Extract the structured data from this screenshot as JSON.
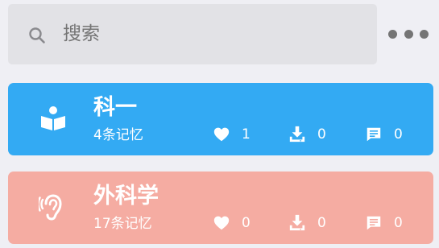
{
  "search": {
    "placeholder": "搜索"
  },
  "header": {
    "more_icon": "more-horizontal-icon"
  },
  "cards": [
    {
      "title": "科一",
      "subtitle": "4条记忆",
      "icon": "book-reader-icon",
      "color": "#33aaf3",
      "likes": "1",
      "downloads": "0",
      "comments": "0"
    },
    {
      "title": "外科学",
      "subtitle": "17条记忆",
      "icon": "ear-icon",
      "color": "#f5aca2",
      "likes": "0",
      "downloads": "0",
      "comments": "0"
    }
  ],
  "icons": {
    "like": "heart-icon",
    "download": "download-icon",
    "comment": "comment-icon"
  },
  "colors": {
    "background": "#efeff4",
    "search_background": "#e2e2e6",
    "text_on_card": "#ffffff",
    "muted": "#8e8e93"
  }
}
